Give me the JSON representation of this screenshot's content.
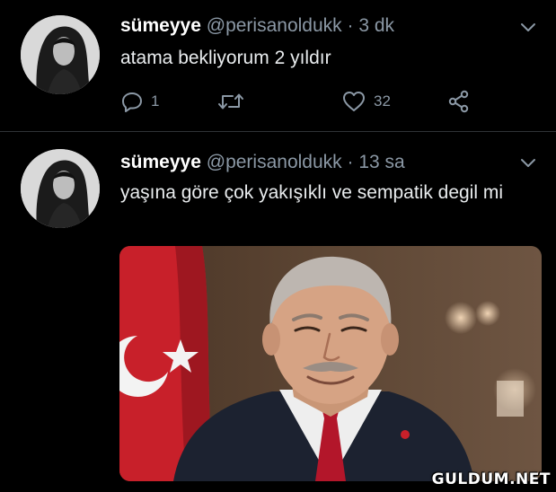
{
  "tweets": [
    {
      "display_name": "sümeyye",
      "handle": "@perisanoldukk",
      "separator": "·",
      "time": "3 dk",
      "text": "atama bekliyorum 2 yıldır",
      "reply_count": "1",
      "retweet_count": "",
      "like_count": "32"
    },
    {
      "display_name": "sümeyye",
      "handle": "@perisanoldukk",
      "separator": "·",
      "time": "13 sa",
      "text": "yaşına göre çok yakışıklı ve sempatik degil mi"
    }
  ],
  "icons": {
    "reply": "reply-icon",
    "retweet": "retweet-icon",
    "like": "heart-icon",
    "share": "share-icon",
    "more": "chevron-down-icon"
  },
  "colors": {
    "background": "#000000",
    "text": "#e9ecee",
    "muted": "#8b98a5",
    "divider": "#2f3336"
  },
  "watermark": "GULDUM.NET"
}
